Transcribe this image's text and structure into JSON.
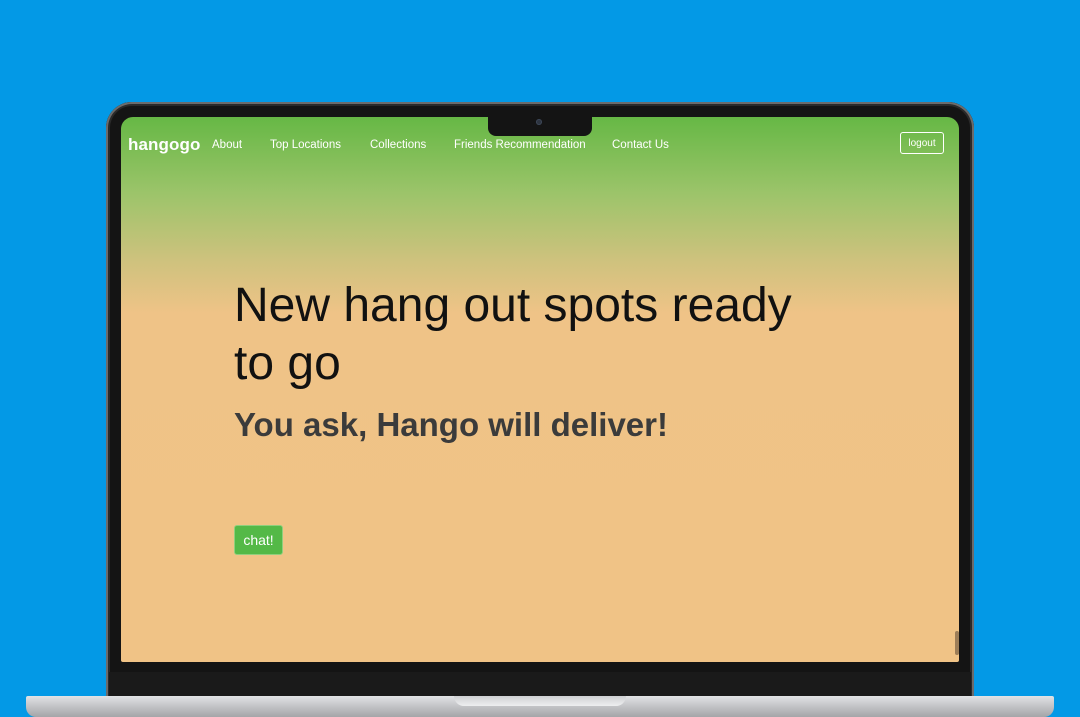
{
  "app": {
    "brand": "hangogo"
  },
  "nav": {
    "links": [
      {
        "label": "About"
      },
      {
        "label": "Top Locations"
      },
      {
        "label": "Collections"
      },
      {
        "label": "Friends Recommendation"
      },
      {
        "label": "Contact Us"
      }
    ],
    "logout_label": "logout"
  },
  "hero": {
    "title": "New hang out spots ready to go",
    "subtitle": "You ask, Hango will deliver!",
    "chat_label": "chat!"
  },
  "colors": {
    "background": "#0399e6",
    "gradient_top": "#66b845",
    "gradient_bottom": "#f0c386",
    "chat_button": "#54b947"
  }
}
